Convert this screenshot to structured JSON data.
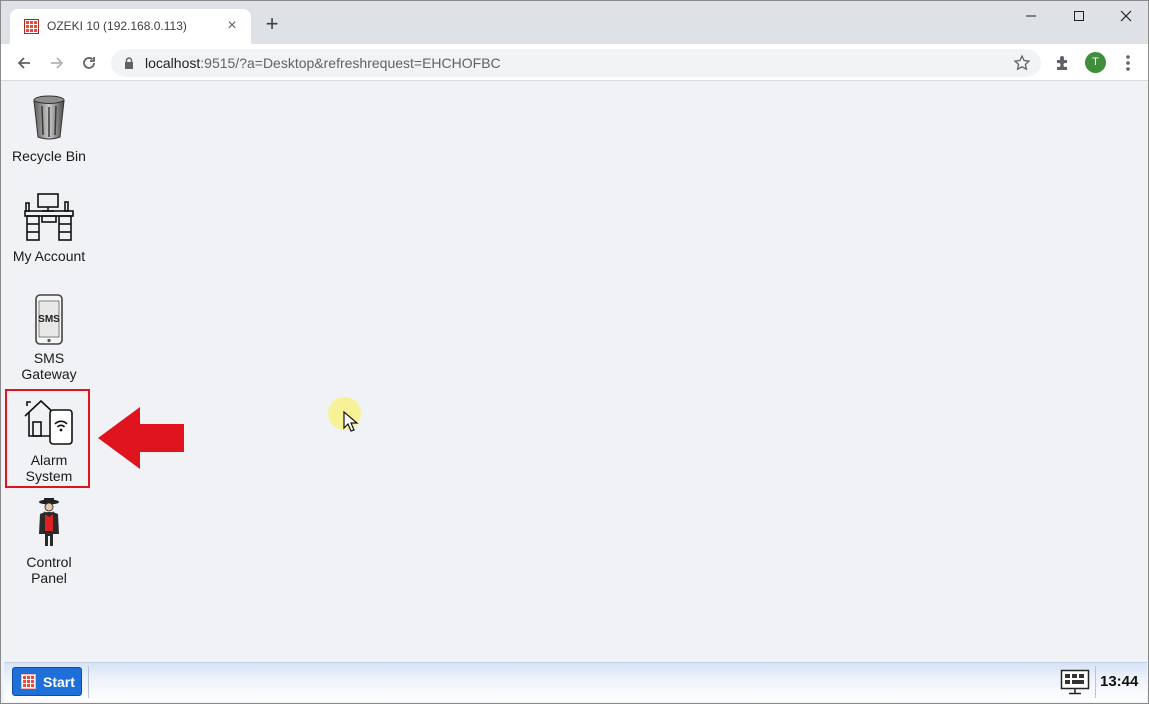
{
  "browser": {
    "tab_title": "OZEKI 10 (192.168.0.113)",
    "tab_close": "×",
    "new_tab": "+",
    "url_host": "localhost",
    "url_rest": ":9515/?a=Desktop&refreshrequest=EHCHOFBC",
    "profile_initial": "T"
  },
  "desktop": {
    "icons": [
      {
        "label": "Recycle Bin",
        "icon": "recycle-bin-icon"
      },
      {
        "label": "My Account",
        "icon": "desk-computer-icon"
      },
      {
        "label": "SMS\nGateway",
        "icon": "sms-phone-icon"
      },
      {
        "label": "Alarm\nSystem",
        "icon": "house-phone-wifi-icon"
      },
      {
        "label": "Control\nPanel",
        "icon": "spy-figure-icon"
      }
    ],
    "highlight_color": "#e0141e"
  },
  "taskbar": {
    "start_label": "Start",
    "clock": "13:44"
  }
}
